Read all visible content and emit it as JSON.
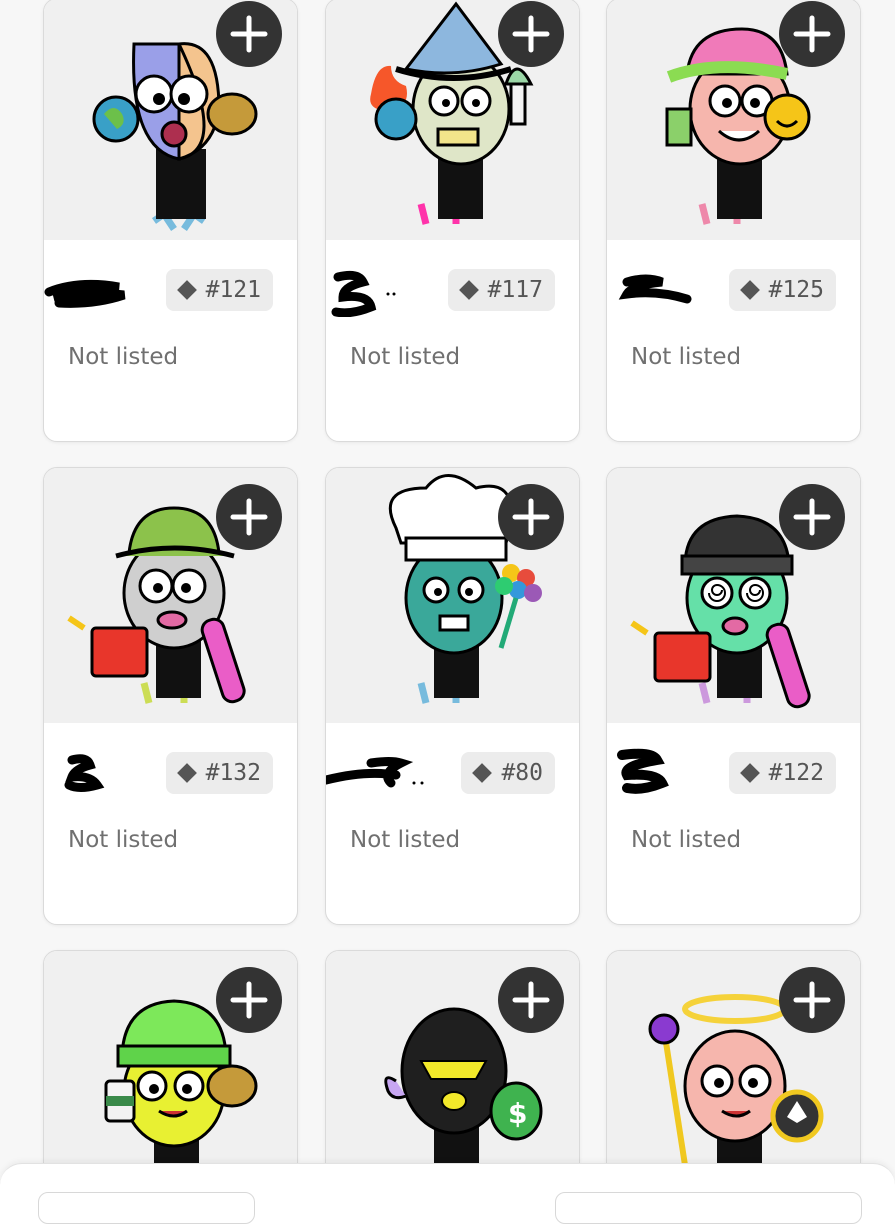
{
  "cards": [
    {
      "token_id": "#121",
      "status": "Not listed",
      "character": "half-purple half-orange furball with globe and cookie"
    },
    {
      "token_id": "#117",
      "status": "Not listed",
      "character": "wizard hat zombie with fiery globe and paint brush"
    },
    {
      "token_id": "#125",
      "status": "Not listed",
      "character": "pink furball with cap, drink and smiley"
    },
    {
      "token_id": "#132",
      "status": "Not listed",
      "character": "grey furball with bucket hat, gas can and skateboard"
    },
    {
      "token_id": "#80",
      "status": "Not listed",
      "character": "teal chef with flower bouquet"
    },
    {
      "token_id": "#122",
      "status": "Not listed",
      "character": "green zombie with beanie, gas can and skateboard"
    },
    {
      "token_id": "",
      "status": "",
      "character": "yellow furball with green beanie, coffee and cookie"
    },
    {
      "token_id": "",
      "status": "",
      "character": "ski-mask furball with money bag"
    },
    {
      "token_id": "",
      "status": "",
      "character": "pink angel with halo, scepter and coin"
    }
  ],
  "icons": {
    "add": "plus-icon",
    "token": "diamond-icon"
  },
  "colors": {
    "button": "#333333",
    "card_bg": "#ffffff",
    "art_bg": "#f0f0f0",
    "chip_bg": "#ececec",
    "status_text": "#707070"
  }
}
